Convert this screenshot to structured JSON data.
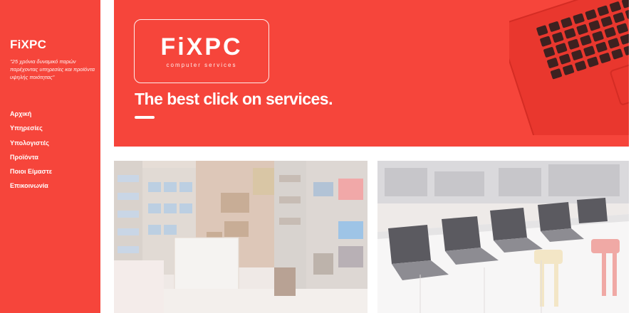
{
  "sidebar": {
    "brand": "FiXPC",
    "tagline": "\"25 χρόνια δυναμικό παρών παρέχοντας υπηρεσίες και προϊόντα υψηλής ποιότητας\"",
    "nav": [
      {
        "label": "Αρχική"
      },
      {
        "label": "Υπηρεσίες"
      },
      {
        "label": "Υπολογιστές"
      },
      {
        "label": "Προϊόντα"
      },
      {
        "label": "Ποιοι Είμαστε"
      },
      {
        "label": "Επικοινωνία"
      }
    ]
  },
  "hero": {
    "logo_text": "FiXPC",
    "logo_sub": "computer services",
    "title": "The best click on services."
  },
  "colors": {
    "brand_red": "#f6453b",
    "white": "#ffffff"
  }
}
